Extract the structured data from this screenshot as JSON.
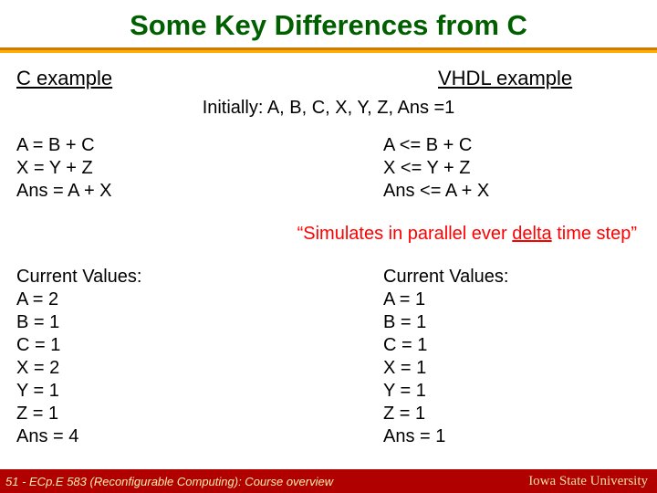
{
  "title": "Some Key Differences from C",
  "labels": {
    "c": "C example",
    "vhdl": "VHDL example"
  },
  "initial": "Initially: A, B, C, X, Y, Z, Ans =1",
  "code": {
    "c": {
      "l1": "A = B + C",
      "l2": "X = Y + Z",
      "l3": "Ans = A + X"
    },
    "vhdl": {
      "l1": "A <= B + C",
      "l2": "X <= Y + Z",
      "l3": "Ans <= A + X"
    }
  },
  "sim": {
    "pre": "“Simulates in parallel ever ",
    "delta": "delta",
    "post": " time step”"
  },
  "vals": {
    "hdr": "Current Values:",
    "c": {
      "A": "A = 2",
      "B": "B = 1",
      "C": "C = 1",
      "X": "X = 2",
      "Y": "Y = 1",
      "Z": "Z = 1",
      "Ans": "Ans = 4"
    },
    "vhdl": {
      "A": "A = 1",
      "B": "B = 1",
      "C": "C = 1",
      "X": "X = 1",
      "Y": "Y = 1",
      "Z": "Z = 1",
      "Ans": "Ans = 1"
    }
  },
  "footer": {
    "left": "51 - ECp.E 583 (Reconfigurable Computing): Course overview",
    "right": "Iowa State University"
  }
}
